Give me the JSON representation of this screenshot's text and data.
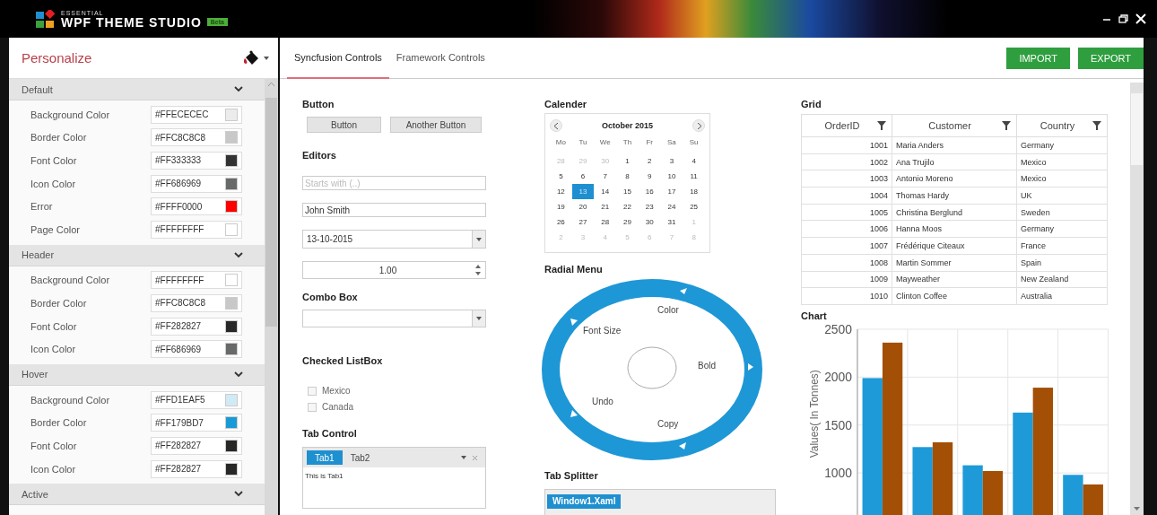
{
  "window": {
    "brand_small": "ESSENTIAL",
    "title": "WPF THEME STUDIO",
    "badge": "Beta"
  },
  "sidebar": {
    "title": "Personalize",
    "sections": [
      {
        "title": "Default",
        "rows": [
          {
            "label": "Background Color",
            "value": "#FFECECEC",
            "color": "#ececec"
          },
          {
            "label": "Border Color",
            "value": "#FFC8C8C8",
            "color": "#c8c8c8"
          },
          {
            "label": "Font Color",
            "value": "#FF333333",
            "color": "#333333"
          },
          {
            "label": "Icon Color",
            "value": "#FF686969",
            "color": "#686969"
          },
          {
            "label": "Error",
            "value": "#FFFF0000",
            "color": "#ff0000"
          },
          {
            "label": "Page Color",
            "value": "#FFFFFFFF",
            "color": "#ffffff"
          }
        ]
      },
      {
        "title": "Header",
        "rows": [
          {
            "label": "Background Color",
            "value": "#FFFFFFFF",
            "color": "#ffffff"
          },
          {
            "label": "Border Color",
            "value": "#FFC8C8C8",
            "color": "#c8c8c8"
          },
          {
            "label": "Font Color",
            "value": "#FF282827",
            "color": "#282827"
          },
          {
            "label": "Icon Color",
            "value": "#FF686969",
            "color": "#686969"
          }
        ]
      },
      {
        "title": "Hover",
        "rows": [
          {
            "label": "Background Color",
            "value": "#FFD1EAF5",
            "color": "#d1eaf5"
          },
          {
            "label": "Border Color",
            "value": "#FF179BD7",
            "color": "#179bd7"
          },
          {
            "label": "Font Color",
            "value": "#FF282827",
            "color": "#282827"
          },
          {
            "label": "Icon Color",
            "value": "#FF282827",
            "color": "#282827"
          }
        ]
      },
      {
        "title": "Active"
      }
    ]
  },
  "tabs": [
    {
      "label": "Syncfusion Controls",
      "selected": true
    },
    {
      "label": "Framework Controls",
      "selected": false
    }
  ],
  "actions": [
    "IMPORT",
    "EXPORT"
  ],
  "button_demo": {
    "title": "Button",
    "buttons": [
      "Button",
      "Another Button"
    ]
  },
  "editors": {
    "title": "Editors",
    "fields": [
      {
        "kind": "text",
        "placeholder": "Starts with (..)"
      },
      {
        "kind": "text",
        "value": "John Smith"
      },
      {
        "kind": "date",
        "value": "13-10-2015"
      },
      {
        "kind": "numeric",
        "value": "1.00"
      }
    ]
  },
  "combo_box": {
    "title": "Combo Box"
  },
  "checked_listbox": {
    "title": "Checked ListBox",
    "items": [
      {
        "label": "Mexico",
        "checked": false
      },
      {
        "label": "Canada",
        "checked": false
      }
    ]
  },
  "tab_control": {
    "title": "Tab Control",
    "tabs": [
      {
        "label": "Tab1",
        "selected": true
      },
      {
        "label": "Tab2",
        "selected": false
      }
    ],
    "content": "This is Tab1"
  },
  "calendar": {
    "title": "Calender",
    "month": "October 2015",
    "weekdays": [
      "Mo",
      "Tu",
      "We",
      "Th",
      "Fr",
      "Sa",
      "Su"
    ],
    "weeks": [
      [
        {
          "day": "28",
          "outside_month": true,
          "selected": false
        },
        {
          "day": "29",
          "outside_month": true,
          "selected": false
        },
        {
          "day": "30",
          "outside_month": true,
          "selected": false
        },
        {
          "day": "1",
          "outside_month": false,
          "selected": false
        },
        {
          "day": "2",
          "outside_month": false,
          "selected": false
        },
        {
          "day": "3",
          "outside_month": false,
          "selected": false
        },
        {
          "day": "4",
          "outside_month": false,
          "selected": false
        }
      ],
      [
        {
          "day": "5",
          "outside_month": false,
          "selected": false
        },
        {
          "day": "6",
          "outside_month": false,
          "selected": false
        },
        {
          "day": "7",
          "outside_month": false,
          "selected": false
        },
        {
          "day": "8",
          "outside_month": false,
          "selected": false
        },
        {
          "day": "9",
          "outside_month": false,
          "selected": false
        },
        {
          "day": "10",
          "outside_month": false,
          "selected": false
        },
        {
          "day": "11",
          "outside_month": false,
          "selected": false
        }
      ],
      [
        {
          "day": "12",
          "outside_month": false,
          "selected": false
        },
        {
          "day": "13",
          "outside_month": false,
          "selected": true
        },
        {
          "day": "14",
          "outside_month": false,
          "selected": false
        },
        {
          "day": "15",
          "outside_month": false,
          "selected": false
        },
        {
          "day": "16",
          "outside_month": false,
          "selected": false
        },
        {
          "day": "17",
          "outside_month": false,
          "selected": false
        },
        {
          "day": "18",
          "outside_month": false,
          "selected": false
        }
      ],
      [
        {
          "day": "19",
          "outside_month": false,
          "selected": false
        },
        {
          "day": "20",
          "outside_month": false,
          "selected": false
        },
        {
          "day": "21",
          "outside_month": false,
          "selected": false
        },
        {
          "day": "22",
          "outside_month": false,
          "selected": false
        },
        {
          "day": "23",
          "outside_month": false,
          "selected": false
        },
        {
          "day": "24",
          "outside_month": false,
          "selected": false
        },
        {
          "day": "25",
          "outside_month": false,
          "selected": false
        }
      ],
      [
        {
          "day": "26",
          "outside_month": false,
          "selected": false
        },
        {
          "day": "27",
          "outside_month": false,
          "selected": false
        },
        {
          "day": "28",
          "outside_month": false,
          "selected": false
        },
        {
          "day": "29",
          "outside_month": false,
          "selected": false
        },
        {
          "day": "30",
          "outside_month": false,
          "selected": false
        },
        {
          "day": "31",
          "outside_month": false,
          "selected": false
        },
        {
          "day": "1",
          "outside_month": true,
          "selected": false
        }
      ],
      [
        {
          "day": "2",
          "outside_month": true,
          "selected": false
        },
        {
          "day": "3",
          "outside_month": true,
          "selected": false
        },
        {
          "day": "4",
          "outside_month": true,
          "selected": false
        },
        {
          "day": "5",
          "outside_month": true,
          "selected": false
        },
        {
          "day": "6",
          "outside_month": true,
          "selected": false
        },
        {
          "day": "7",
          "outside_month": true,
          "selected": false
        },
        {
          "day": "8",
          "outside_month": true,
          "selected": false
        }
      ]
    ]
  },
  "radial_menu": {
    "title": "Radial Menu",
    "items": [
      "Color",
      "Font Size",
      "Bold",
      "Undo",
      "Copy"
    ]
  },
  "tab_splitter": {
    "title": "Tab Splitter",
    "tabs": [
      {
        "label": "Window1.Xaml",
        "selected": true
      }
    ]
  },
  "grid": {
    "title": "Grid",
    "columns": [
      "OrderID",
      "Customer",
      "Country"
    ],
    "rows": [
      [
        "1001",
        "Maria Anders",
        "Germany"
      ],
      [
        "1002",
        "Ana Trujilo",
        "Mexico"
      ],
      [
        "1003",
        "Antonio Moreno",
        "Mexico"
      ],
      [
        "1004",
        "Thomas Hardy",
        "UK"
      ],
      [
        "1005",
        "Christina Berglund",
        "Sweden"
      ],
      [
        "1006",
        "Hanna Moos",
        "Germany"
      ],
      [
        "1007",
        "Frédérique Citeaux",
        "France"
      ],
      [
        "1008",
        "Martin Sommer",
        "Spain"
      ],
      [
        "1009",
        "Mayweather",
        "New Zealand"
      ],
      [
        "1010",
        "Clinton Coffee",
        "Australia"
      ]
    ]
  },
  "chart": {
    "title": "Chart",
    "chart_data": {
      "type": "bar",
      "grid": true,
      "ylabel": "Values( In Tonnes)",
      "ylim": [
        560,
        2500
      ],
      "yticks": [
        1000,
        1500,
        2000,
        2500
      ],
      "series": [
        {
          "color": "#1e9ad8",
          "values": [
            1990,
            1270,
            1080,
            1630,
            980
          ]
        },
        {
          "color": "#a34f06",
          "values": [
            2360,
            1320,
            1020,
            1890,
            880
          ]
        }
      ]
    }
  }
}
